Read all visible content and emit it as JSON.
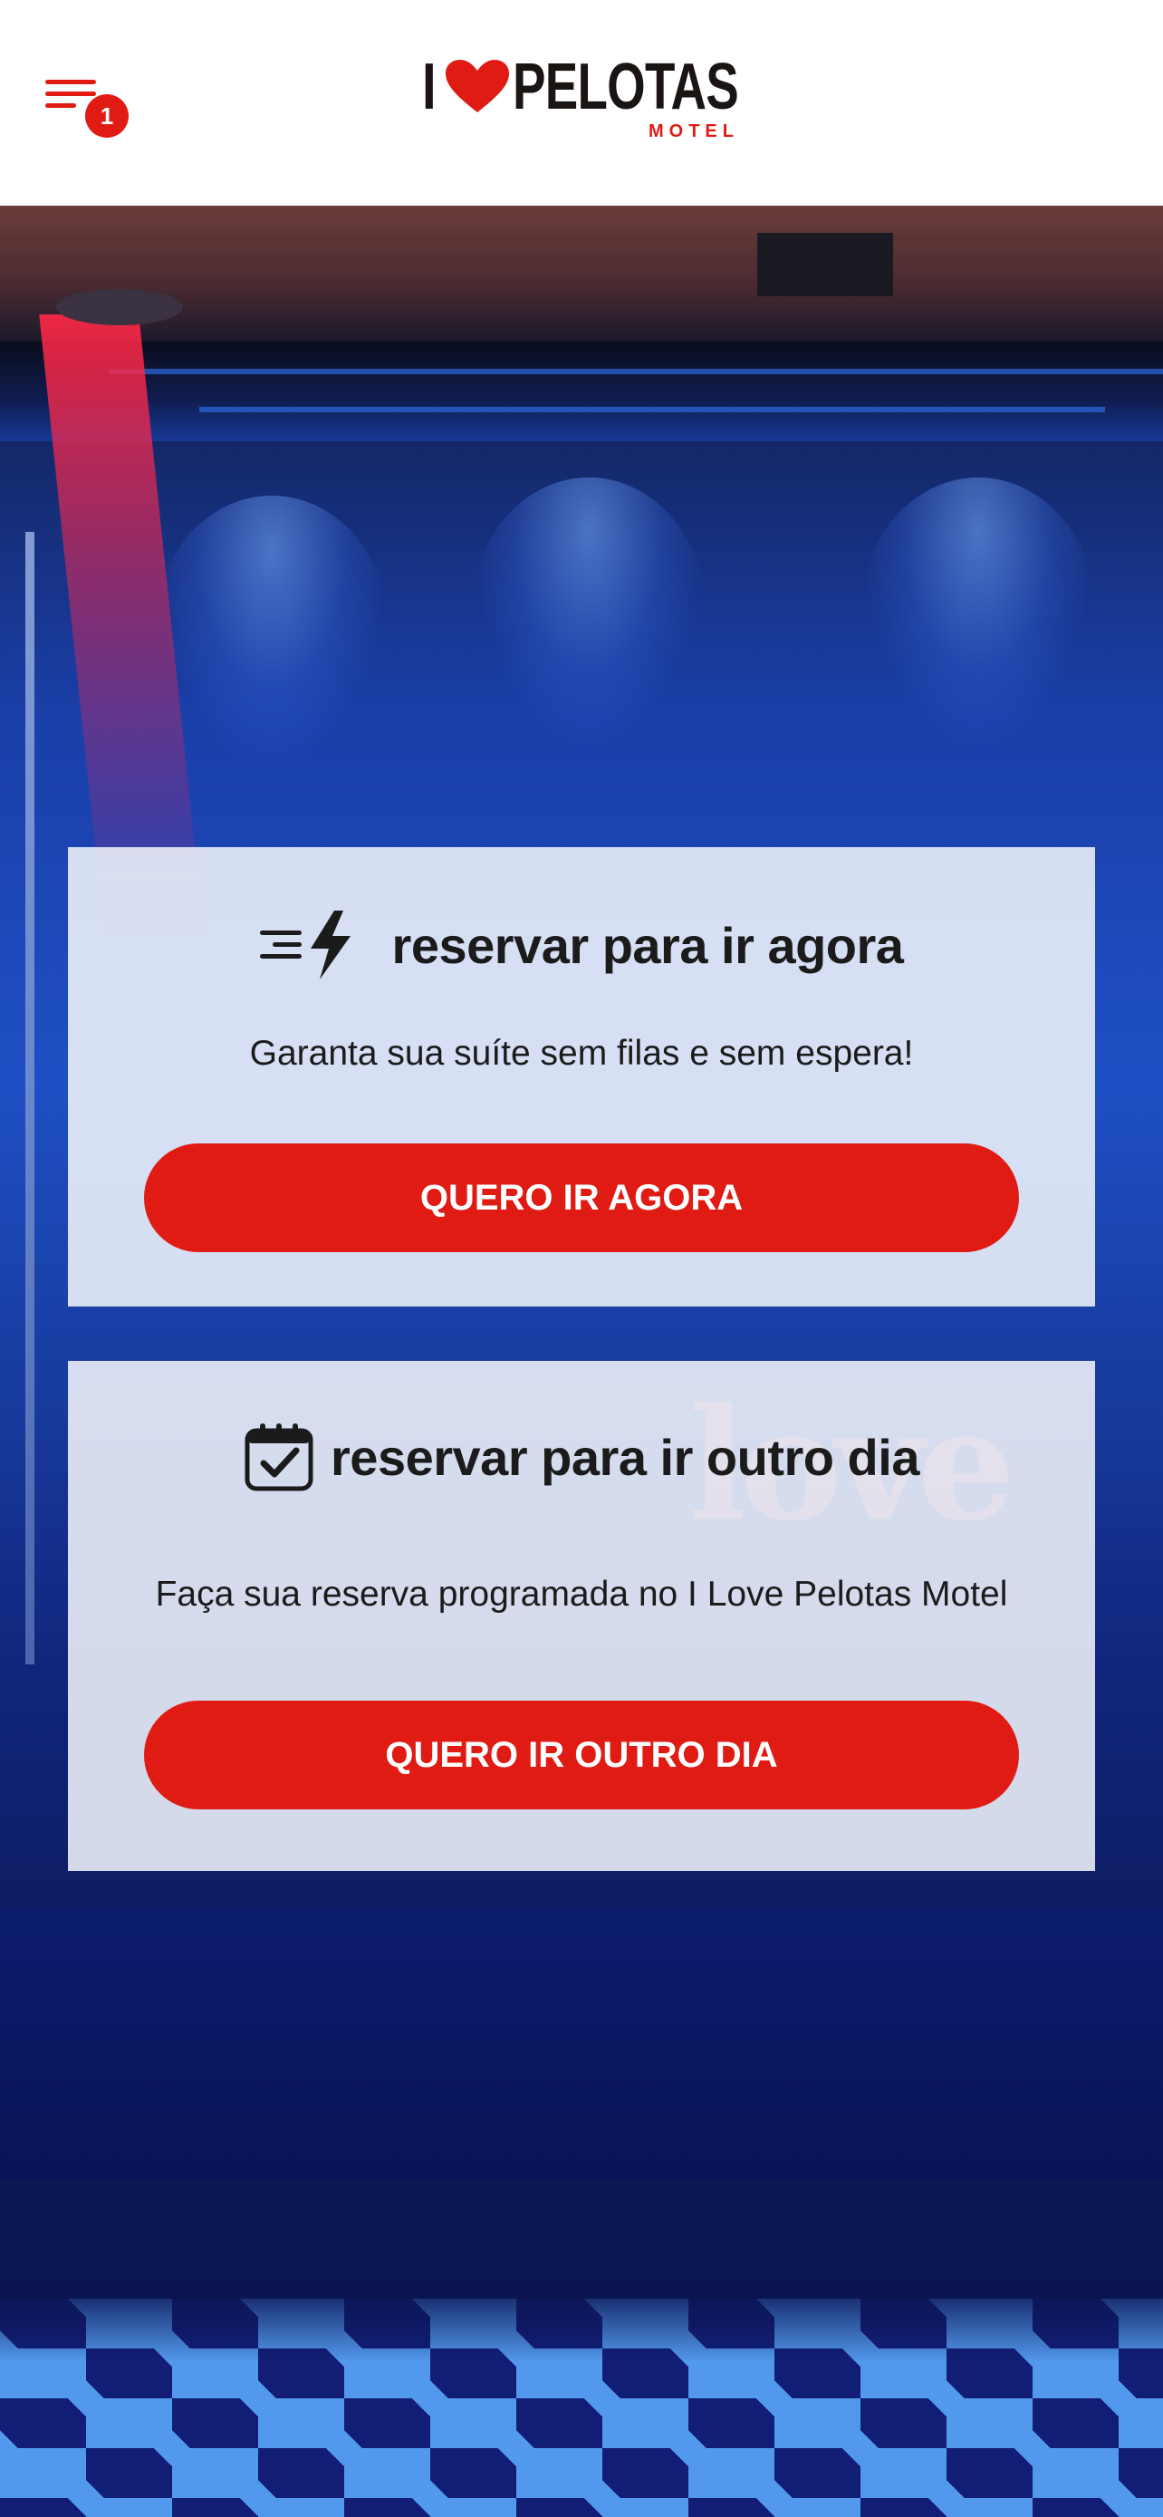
{
  "header": {
    "menu": {
      "icon": "menu-lines-icon",
      "badge_count": "1"
    },
    "logo": {
      "i": "I",
      "heart_icon": "heart-icon",
      "name": "PELOTAS",
      "subtitle": "MOTEL"
    }
  },
  "cards": [
    {
      "icon": "fast-lightning-icon",
      "title": "reservar para ir agora",
      "description": "Garanta sua suíte sem filas e sem espera!",
      "button_label": "QUERO IR AGORA"
    },
    {
      "icon": "calendar-check-icon",
      "title": "reservar para ir outro dia",
      "description": "Faça sua reserva programada no I Love Pelotas Motel",
      "button_label": "QUERO IR OUTRO DIA"
    }
  ],
  "background": {
    "sign_text": "love"
  },
  "colors": {
    "brand_red": "#e01b13",
    "text_dark": "#1b1b1b",
    "card_bg": "#f0f4fa",
    "header_bg": "#ffffff"
  }
}
